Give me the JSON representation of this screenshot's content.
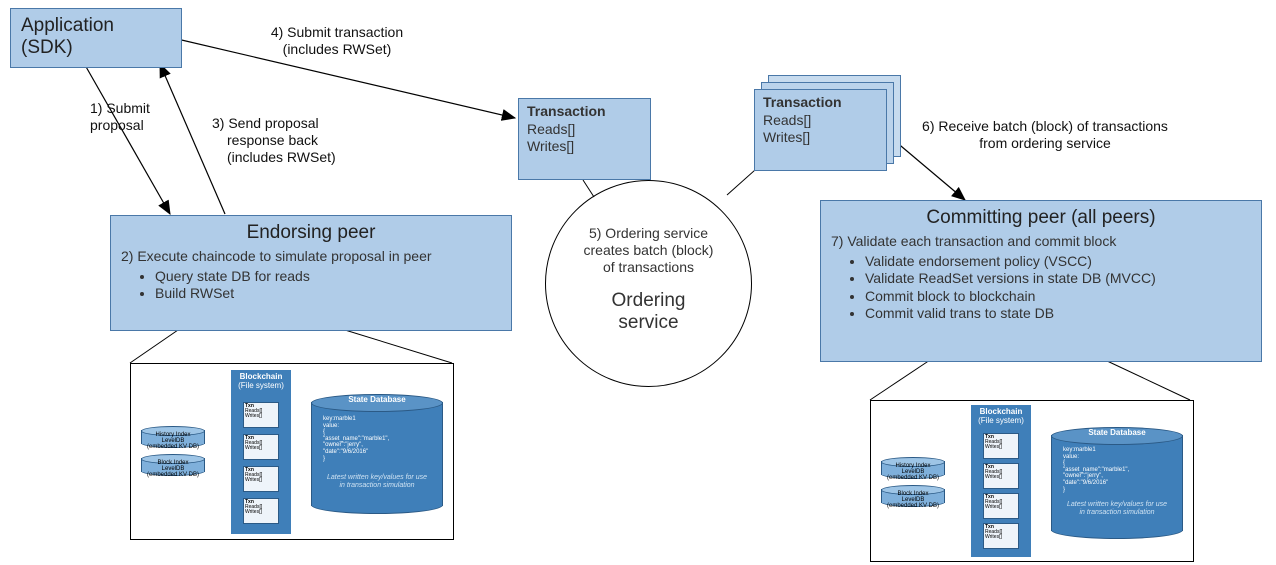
{
  "app": {
    "title_l1": "Application",
    "title_l2": "(SDK)"
  },
  "txn": {
    "hdr": "Transaction",
    "reads": "Reads[]",
    "writes": "Writes[]"
  },
  "ordering": {
    "step5_l1": "5) Ordering service",
    "step5_l2": "creates batch (block)",
    "step5_l3": "of transactions",
    "label_l1": "Ordering",
    "label_l2": "service"
  },
  "step1": {
    "l1": "1) Submit",
    "l2": "proposal"
  },
  "step3": {
    "l1": "3) Send proposal",
    "l2": "response back",
    "l3": "(includes RWSet)"
  },
  "step4": {
    "l1": "4) Submit transaction",
    "l2": "(includes RWSet)"
  },
  "step6": {
    "l1": "6) Receive batch (block) of transactions",
    "l2": "from ordering service"
  },
  "endorse": {
    "title": "Endorsing peer",
    "step2": "2) Execute chaincode to simulate proposal in peer",
    "b1": "Query state DB for reads",
    "b2": "Build RWSet"
  },
  "commit": {
    "title": "Committing peer (all peers)",
    "step7": "7) Validate each transaction and commit block",
    "b1": "Validate endorsement policy (VSCC)",
    "b2": "Validate ReadSet versions in state DB (MVCC)",
    "b3": "Commit block to blockchain",
    "b4": "Commit valid trans to state DB"
  },
  "blockchain": {
    "title_l1": "Blockchain",
    "title_l2": "(File system)",
    "tiny_hdr": "Txn",
    "tiny_reads": "Reads[]",
    "tiny_writes": "Writes[]"
  },
  "statedb": {
    "title": "State Database",
    "key": "key:marble1",
    "val": "value:",
    "j1": "{",
    "j2": "\"asset_name\":\"marble1\",",
    "j3": "\"owner\":\"jerry\",",
    "j4": "\"date\":\"9/6/2016\"",
    "j5": "}",
    "note_l1": "Latest written key/values for use",
    "note_l2": "in transaction simulation"
  },
  "idx": {
    "hist_l1": "History Index",
    "hist_l2": "LevelDB",
    "hist_l3": "(embedded KV DB)",
    "block_l1": "Block Index",
    "block_l2": "LevelDB",
    "block_l3": "(embedded KV DB)"
  }
}
